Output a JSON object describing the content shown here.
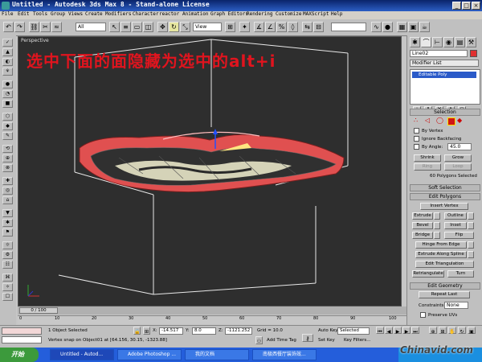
{
  "window": {
    "title": "Untitled - Autodesk 3ds Max 8 - Stand-alone License"
  },
  "menu": [
    "File",
    "Edit",
    "Tools",
    "Group",
    "Views",
    "Create",
    "Modifiers",
    "Character",
    "reactor",
    "Animation",
    "Graph Editors",
    "Rendering",
    "Customize",
    "MAXScript",
    "Help"
  ],
  "toolbar": {
    "selection_filter": "All",
    "ref_coord": "View"
  },
  "viewport": {
    "label": "Perspective",
    "overlay_text": "选中下面的面隐藏为选中的alt+i"
  },
  "command_panel": {
    "object_name": "Line02",
    "modifier_list": "Modifier List",
    "stack_item": "Editable Poly",
    "selection": {
      "header": "Selection",
      "by_vertex": "By Vertex",
      "ignore_backfacing": "Ignore Backfacing",
      "by_angle": "By Angle:",
      "by_angle_value": "45.0",
      "shrink": "Shrink",
      "grow": "Grow",
      "ring": "Ring",
      "loop": "Loop",
      "status": "60 Polygons Selected"
    },
    "soft_selection": "Soft Selection",
    "edit_polygons": {
      "header": "Edit Polygons",
      "insert_vertex": "Insert Vertex",
      "extrude": "Extrude",
      "outline": "Outline",
      "bevel": "Bevel",
      "inset": "Inset",
      "bridge": "Bridge",
      "flip": "Flip",
      "hinge": "Hinge From Edge",
      "extrude_spline": "Extrude Along Spline",
      "edit_tri": "Edit Triangulation",
      "retriangulate": "Retriangulate",
      "turn": "Turn"
    },
    "edit_geometry": {
      "header": "Edit Geometry",
      "repeat_last": "Repeat Last",
      "constraints": "Constraints:",
      "constraints_value": "None",
      "preserve_uvs": "Preserve UVs"
    }
  },
  "timeline": {
    "slider": "0 / 100",
    "ticks": [
      "0",
      "10",
      "20",
      "30",
      "40",
      "50",
      "60",
      "70",
      "80",
      "90",
      "100"
    ]
  },
  "status": {
    "selected": "1 Object Selected",
    "prompt": "Vertex snap on Object01 at [64.156, 30.15, -1323.88]",
    "x": "-14.517",
    "y": "8.0",
    "z": "-1121.252",
    "grid": "Grid = 10.0",
    "add_time_tag": "Add Time Tag",
    "auto_key": "Auto Key",
    "set_key": "Set Key",
    "key_mode": "Selected",
    "key_filters": "Key Filters..."
  },
  "taskbar": {
    "start": "开始",
    "tasks": [
      "Untitled - Autod...",
      "Adobe Photoshop ...",
      "我的文档",
      "南极西餐厅装饰效..."
    ]
  },
  "watermark": "Chinavid.com",
  "colors": {
    "accent_title": "#0a246a",
    "overlay_red": "#e0141e",
    "taskbar_blue": "#245edb",
    "mesh_red": "#e05050",
    "mesh_cream": "#e8e6c8"
  }
}
